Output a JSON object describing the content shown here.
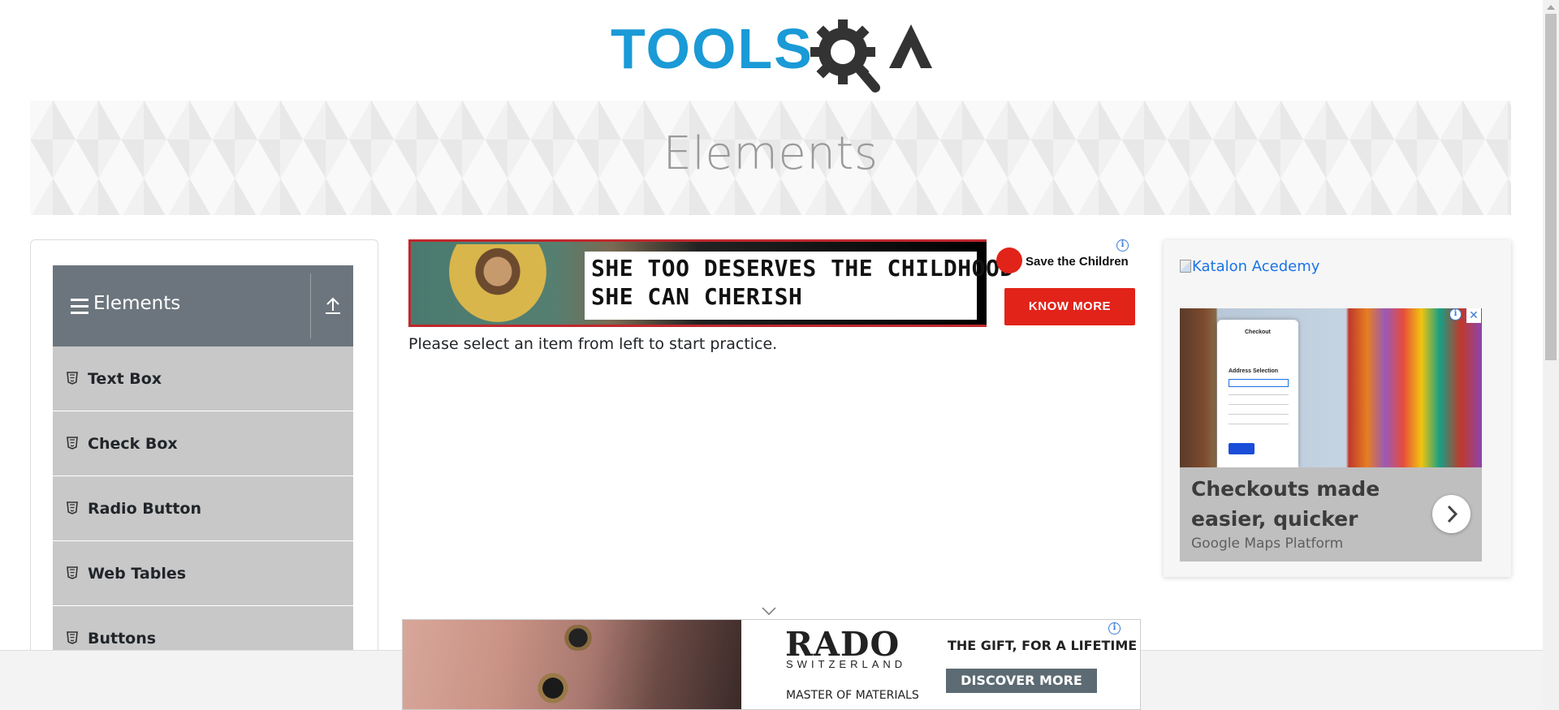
{
  "logo": {
    "text_main": "TOOLS",
    "text_suffix": "QA",
    "color_main": "#1a9ad6",
    "color_dark": "#333333"
  },
  "banner": {
    "title": "Elements"
  },
  "sidebar": {
    "group_title": "Elements",
    "items": [
      {
        "label": "Text Box"
      },
      {
        "label": "Check Box"
      },
      {
        "label": "Radio Button"
      },
      {
        "label": "Web Tables"
      },
      {
        "label": "Buttons"
      }
    ]
  },
  "main": {
    "instruction": "Please select an item from left to start practice."
  },
  "ad_top": {
    "line1": "SHE TOO DESERVES THE CHILDHOOD",
    "line2": "SHE CAN CHERISH",
    "brand": "Save the Children",
    "cta": "KNOW MORE",
    "info": "i"
  },
  "ad_right": {
    "broken_image_alt": "Katalon Acedemy",
    "phone_title": "Checkout",
    "phone_section": "Address Selection",
    "headline": "Checkouts made easier, quicker",
    "brand": "Google Maps Platform",
    "info": "i",
    "close": "✕"
  },
  "ad_bottom": {
    "brand": "RADO",
    "country": "SWITZERLAND",
    "tagline": "MASTER OF MATERIALS",
    "gift": "THE GIFT, FOR A LIFETIME",
    "cta": "DISCOVER MORE",
    "info": "i"
  },
  "colors": {
    "sidebar_header": "#6c757d",
    "sidebar_item": "#c8c8c8",
    "link": "#1a73e8",
    "ad_red": "#e2231a"
  }
}
